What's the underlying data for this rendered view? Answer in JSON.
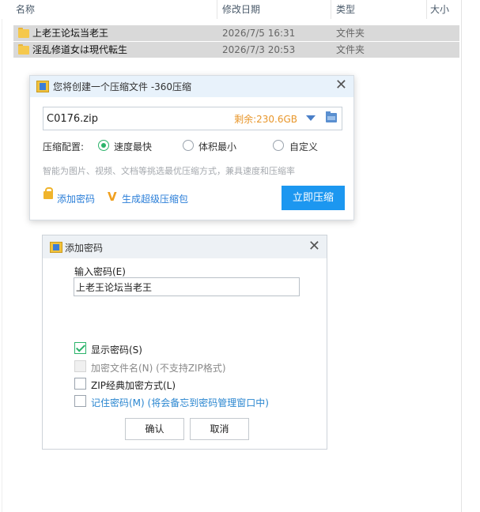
{
  "explorer": {
    "columns": {
      "name": "名称",
      "modified": "修改日期",
      "type": "类型",
      "size": "大小"
    },
    "files": [
      {
        "name": "上老王论坛当老王",
        "modified": "2026/7/5 16:31",
        "type": "文件夹"
      },
      {
        "name": "淫乱修道女は現代転生",
        "modified": "2026/7/3 20:53",
        "type": "文件夹"
      }
    ]
  },
  "zip_dialog": {
    "title": "您将创建一个压缩文件 -360压缩",
    "filename": "C0176.zip",
    "free_space": "剩余:230.6GB",
    "config_label": "压缩配置:",
    "options": [
      {
        "label": "速度最快",
        "checked": true
      },
      {
        "label": "体积最小",
        "checked": false
      },
      {
        "label": "自定义",
        "checked": false
      }
    ],
    "hint": "智能为图片、视频、文档等挑选最优压缩方式，兼具速度和压缩率",
    "add_password": "添加密码",
    "super_zip": "生成超级压缩包",
    "compress_button": "立即压缩"
  },
  "password_dialog": {
    "title": "添加密码",
    "input_label": "输入密码(E)",
    "password_value": "上老王论坛当老王",
    "checkboxes": [
      {
        "label": "显示密码(S)",
        "checked": true,
        "disabled": false
      },
      {
        "label": "加密文件名(N) (不支持ZIP格式)",
        "checked": false,
        "disabled": true
      },
      {
        "label": "ZIP经典加密方式(L)",
        "checked": false,
        "disabled": false
      },
      {
        "label": "记住密码(M) (将会备忘到密码管理窗口中)",
        "checked": false,
        "disabled": false
      }
    ],
    "ok_button": "确认",
    "cancel_button": "取消"
  },
  "colors": {
    "accent_blue": "#1c97f0",
    "link_blue": "#2a7ed8",
    "free_space_orange": "#e8962a",
    "radio_green": "#2bb36a",
    "row_selected": "#d9d9d9"
  }
}
